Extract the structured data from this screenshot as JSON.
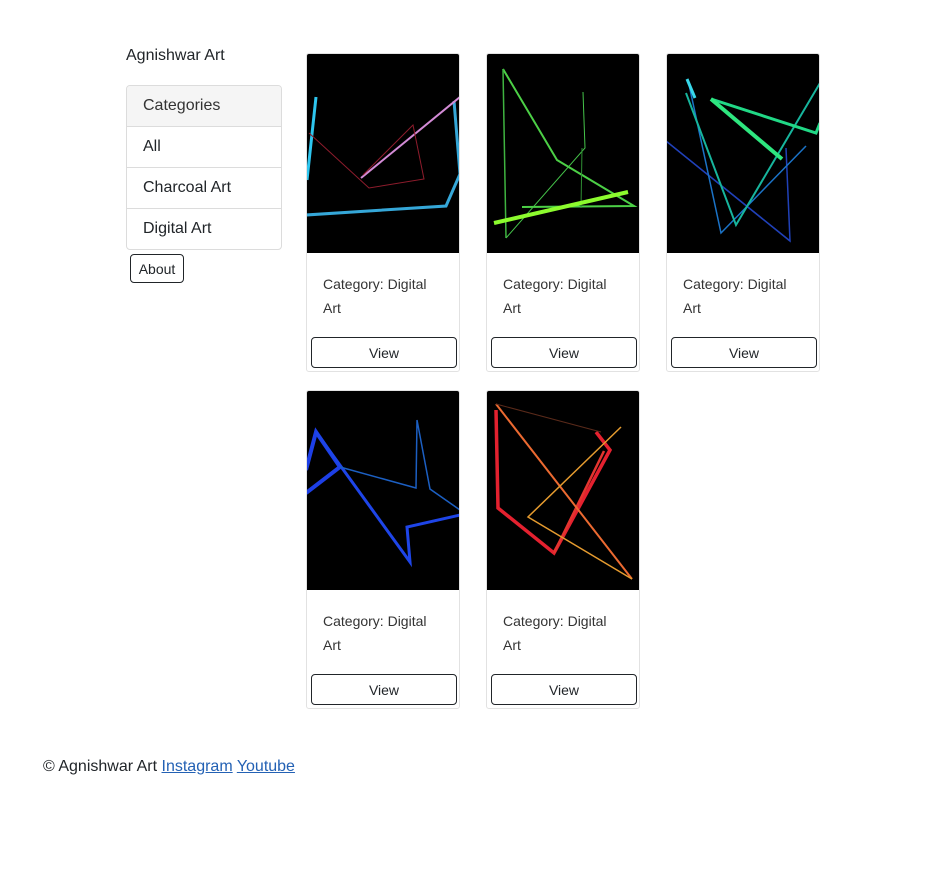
{
  "brand": "Agnishwar Art",
  "sidebar": {
    "header": "Categories",
    "items": [
      "All",
      "Charcoal Art",
      "Digital Art"
    ],
    "about_label": "About"
  },
  "cards": [
    {
      "category": "Category: Digital Art",
      "view_label": "View",
      "artwork": "abstract-lines-cyan-pink"
    },
    {
      "category": "Category: Digital Art",
      "view_label": "View",
      "artwork": "abstract-lines-green"
    },
    {
      "category": "Category: Digital Art",
      "view_label": "View",
      "artwork": "abstract-lines-teal-blue"
    },
    {
      "category": "Category: Digital Art",
      "view_label": "View",
      "artwork": "abstract-lines-blue"
    },
    {
      "category": "Category: Digital Art",
      "view_label": "View",
      "artwork": "abstract-lines-red-orange"
    }
  ],
  "footer": {
    "copyright": "© Agnishwar Art",
    "links": [
      "Instagram",
      "Youtube"
    ]
  },
  "colors": {
    "link": "#2361b4",
    "image_background": "#000000"
  }
}
